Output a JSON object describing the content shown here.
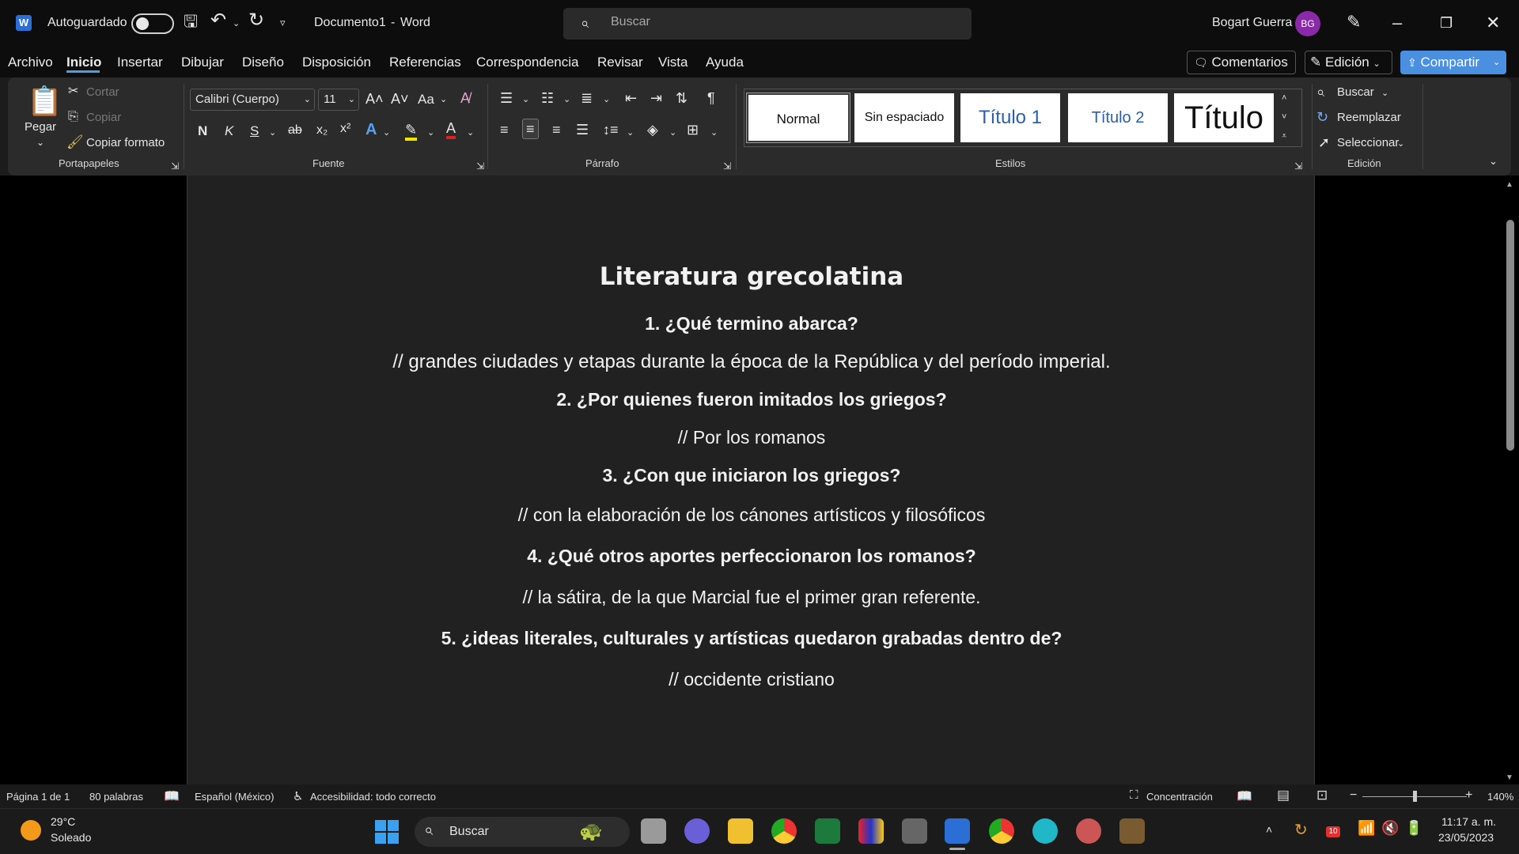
{
  "titlebar": {
    "autosave_label": "Autoguardado",
    "doc_name": "Documento1",
    "separator": "-",
    "app_name": "Word",
    "search_placeholder": "Buscar",
    "user_name": "Bogart Guerra",
    "user_initials": "BG"
  },
  "menu": {
    "tabs": [
      "Archivo",
      "Inicio",
      "Insertar",
      "Dibujar",
      "Diseño",
      "Disposición",
      "Referencias",
      "Correspondencia",
      "Revisar",
      "Vista",
      "Ayuda"
    ],
    "comments": "Comentarios",
    "editing": "Edición",
    "share": "Compartir"
  },
  "ribbon": {
    "clipboard": {
      "paste": "Pegar",
      "cut": "Cortar",
      "copy": "Copiar",
      "format_painter": "Copiar formato",
      "label": "Portapapeles"
    },
    "font": {
      "family": "Calibri (Cuerpo)",
      "size": "11",
      "label": "Fuente",
      "bold": "N",
      "italic": "K",
      "underline": "S",
      "strike": "ab",
      "sub": "x₂",
      "sup": "x²",
      "case": "Aa"
    },
    "paragraph": {
      "label": "Párrafo"
    },
    "styles": {
      "items": [
        "Normal",
        "Sin espaciado",
        "Título 1",
        "Título 2",
        "Título"
      ],
      "label": "Estilos"
    },
    "editing": {
      "find": "Buscar",
      "replace": "Reemplazar",
      "select": "Seleccionar",
      "label": "Edición"
    }
  },
  "document": {
    "title": "Literatura grecolatina",
    "lines": [
      "1. ¿Qué termino abarca?",
      "// grandes ciudades y etapas durante la época de la República y del período imperial.",
      "2. ¿Por quienes fueron imitados los griegos?",
      "// Por los romanos",
      "3. ¿Con que iniciaron los griegos?",
      "// con la elaboración de los cánones artísticos y filosóficos",
      "4. ¿Qué otros aportes perfeccionaron los romanos?",
      "// la sátira, de la que Marcial fue el primer gran referente.",
      "5. ¿ideas literales, culturales y artísticas quedaron grabadas dentro de?",
      "// occidente cristiano"
    ]
  },
  "status": {
    "page": "Página 1 de 1",
    "words": "80 palabras",
    "language": "Español (México)",
    "accessibility": "Accesibilidad: todo correcto",
    "focus": "Concentración",
    "zoom": "140%",
    "zoom_minus": "−",
    "zoom_plus": "+"
  },
  "taskbar": {
    "temp": "29°C",
    "weather": "Soleado",
    "search": "Buscar",
    "time": "11:17 a. m.",
    "date": "23/05/2023",
    "badge": "10"
  },
  "colors": {
    "accent": "#4c9fe6",
    "share_button": "#4a8fe0",
    "avatar": "#8a2aa8"
  }
}
